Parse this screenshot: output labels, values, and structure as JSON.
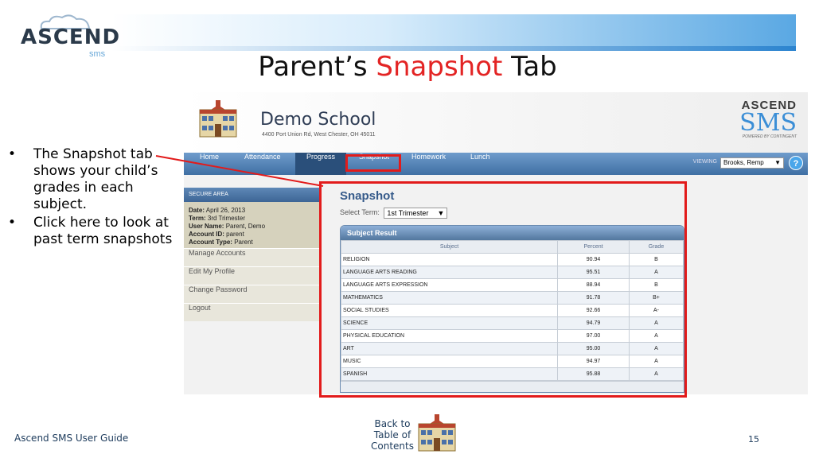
{
  "slide": {
    "logo_text": "ASCEND",
    "logo_sub": "sms",
    "title_prefix": "Parent’s ",
    "title_accent": "Snapshot",
    "title_suffix": " Tab",
    "bullets": [
      "The Snapshot tab shows your child’s grades in each subject.",
      "Click here to look at past term snapshots"
    ],
    "footer_left": "Ascend SMS User Guide",
    "footer_page": "15",
    "back_link": [
      "Back to",
      "Table of",
      "Contents"
    ],
    "colors": {
      "accent": "#e32424",
      "highlight": "#e21b1b",
      "nav": "#3f6fa3"
    }
  },
  "app": {
    "school_name": "Demo School",
    "school_address": "4400 Port Union Rd, West Chester, OH 45011",
    "brand_top": "ASCEND",
    "brand_main": "SMS",
    "brand_sub": "POWERED BY CONTINGENT",
    "nav_tabs": [
      "Home",
      "Attendance",
      "Progress",
      "Snapshot",
      "Homework",
      "Lunch"
    ],
    "active_tab": "Progress",
    "viewing_label": "VIEWING",
    "viewing_value": "Brooks, Remp",
    "help_icon": "?",
    "sidebar": {
      "header": "SECURE AREA",
      "info": [
        {
          "label": "Date:",
          "value": " April 26, 2013"
        },
        {
          "label": "Term:",
          "value": " 3rd Trimester"
        },
        {
          "label": "User Name:",
          "value": " Parent, Demo"
        },
        {
          "label": "Account ID:",
          "value": " parent"
        },
        {
          "label": "Account Type:",
          "value": " Parent"
        }
      ],
      "links": [
        "Manage Accounts",
        "Edit My Profile",
        "Change Password",
        "Logout"
      ]
    },
    "main": {
      "heading": "Snapshot",
      "select_label": "Select Term:",
      "select_value": "1st Trimester",
      "panel_title": "Subject Result",
      "columns": [
        "Subject",
        "Percent",
        "Grade"
      ],
      "rows": [
        [
          "RELIGION",
          "90.94",
          "B"
        ],
        [
          "LANGUAGE ARTS READING",
          "95.51",
          "A"
        ],
        [
          "LANGUAGE ARTS EXPRESSION",
          "88.94",
          "B"
        ],
        [
          "MATHEMATICS",
          "91.78",
          "B+"
        ],
        [
          "SOCIAL STUDIES",
          "92.66",
          "A-"
        ],
        [
          "SCIENCE",
          "94.79",
          "A"
        ],
        [
          "PHYSICAL EDUCATION",
          "97.00",
          "A"
        ],
        [
          "ART",
          "95.00",
          "A"
        ],
        [
          "MUSIC",
          "94.97",
          "A"
        ],
        [
          "SPANISH",
          "95.88",
          "A"
        ]
      ]
    }
  }
}
